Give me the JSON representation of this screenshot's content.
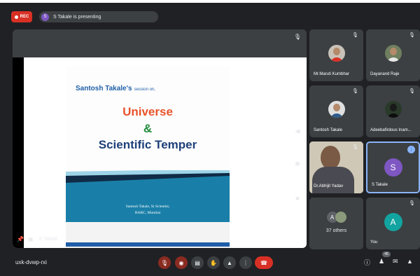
{
  "topbar": {
    "rec_label": "REC",
    "presenter_initial": "S",
    "presenting_text": "S Takale is presenting"
  },
  "slide": {
    "subtitle_name": "Santosh Takale's",
    "subtitle_rest": "session on,",
    "title_line1": "Universe",
    "title_amp": "&",
    "title_line2": "Scientific Temper",
    "footer_line1": "Santosh Takale, Sr Scientist,",
    "footer_line2": "BARC, Mumbai"
  },
  "stage": {
    "presenter_label": "S Takale"
  },
  "participants": [
    {
      "name": "Mr.Maruti Kumbhar"
    },
    {
      "name": "Dayanand Raje"
    },
    {
      "name": "Santosh Takale"
    },
    {
      "name": "Adeebafirdous Inam..."
    },
    {
      "name": "Dr.Abhijit Yadav"
    },
    {
      "name": "S Takale",
      "initial": "S"
    },
    {
      "name": "37 others",
      "initial": "A"
    },
    {
      "name": "You",
      "initial": "A"
    }
  ],
  "bottombar": {
    "meeting_code": "uxk-dvwp-rxi",
    "people_count": "45"
  },
  "colors": {
    "accent": "#8ab4f8",
    "end_call": "#d93025",
    "s_avatar": "#7e57c2",
    "you_avatar": "#12a4a0"
  }
}
